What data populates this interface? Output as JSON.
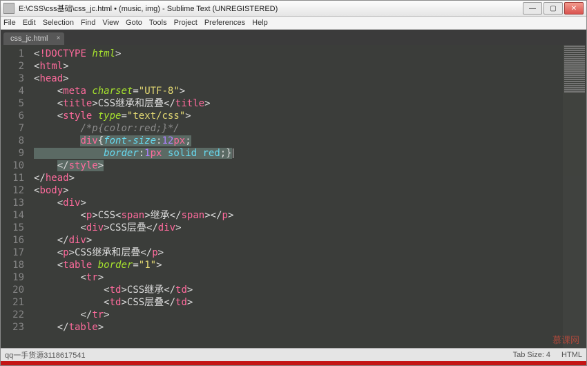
{
  "titlebar": {
    "title": "E:\\CSS\\css基础\\css_jc.html • (music, img) - Sublime Text (UNREGISTERED)"
  },
  "menubar": {
    "file": "File",
    "edit": "Edit",
    "selection": "Selection",
    "find": "Find",
    "view": "View",
    "goto": "Goto",
    "tools": "Tools",
    "project": "Project",
    "preferences": "Preferences",
    "help": "Help"
  },
  "tab": {
    "label": "css_jc.html",
    "close": "×"
  },
  "gutter": {
    "lines": [
      "1",
      "2",
      "3",
      "4",
      "5",
      "6",
      "7",
      "8",
      "9",
      "10",
      "11",
      "12",
      "13",
      "14",
      "15",
      "16",
      "17",
      "18",
      "19",
      "20",
      "21",
      "22",
      "23"
    ]
  },
  "code": {
    "l1_doctype": "!DOCTYPE",
    "l1_html": "html",
    "l2_html": "html",
    "l3_head": "head",
    "l4_meta": "meta",
    "l4_charset": "charset",
    "l4_utf": "\"UTF-8\"",
    "l5_title": "title",
    "l5_text": "CSS继承和层叠",
    "l6_style": "style",
    "l6_type": "type",
    "l6_css": "\"text/css\"",
    "l7_comm": "/*p{color:red;}*/",
    "l8_div": "div",
    "l8_prop": "font-size",
    "l8_val": "12",
    "l8_px": "px",
    "l9_prop": "border",
    "l9_1": "1",
    "l9_px": "px",
    "l9_solid": "solid",
    "l9_red": "red",
    "l10_style": "style",
    "l11_head": "head",
    "l12_body": "body",
    "l13_div": "div",
    "l14_p": "p",
    "l14_txt1": "CSS",
    "l14_span": "span",
    "l14_txt2": "继承",
    "l15_div": "div",
    "l15_txt": "CSS层叠",
    "l16_div": "div",
    "l17_p": "p",
    "l17_txt": "CSS继承和层叠",
    "l18_table": "table",
    "l18_border": "border",
    "l18_1": "\"1\"",
    "l19_tr": "tr",
    "l20_td": "td",
    "l20_txt": "CSS继承",
    "l21_td": "td",
    "l21_txt": "CSS层叠",
    "l22_tr": "tr",
    "l23_table": "table"
  },
  "statusbar": {
    "left": "qq一手货源3118617541",
    "tabsize": "Tab Size: 4",
    "syntax": "HTML"
  },
  "watermark": "慕课网"
}
